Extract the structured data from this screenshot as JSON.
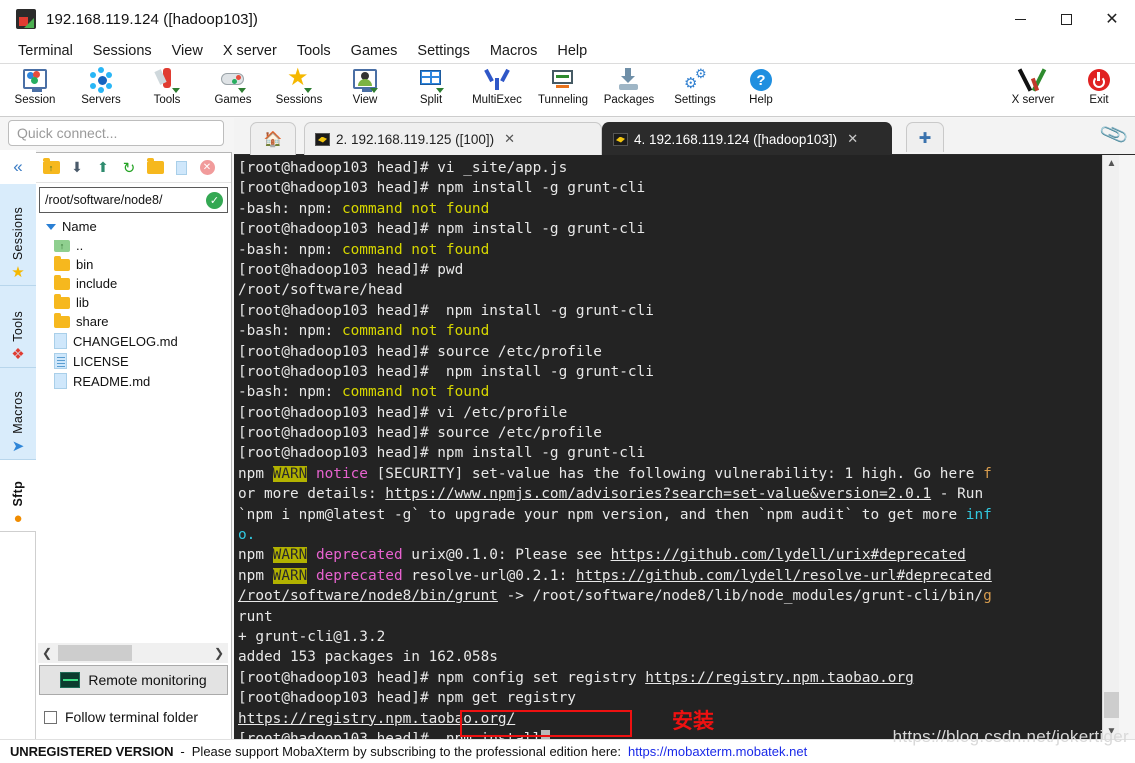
{
  "window": {
    "title": "192.168.119.124 ([hadoop103])",
    "icon": "mobaxterm-logo-icon",
    "controls": {
      "minimize": "–",
      "maximize": "□",
      "close": "✕"
    }
  },
  "menubar": [
    "Terminal",
    "Sessions",
    "View",
    "X server",
    "Tools",
    "Games",
    "Settings",
    "Macros",
    "Help"
  ],
  "toolbar": {
    "left_items": [
      {
        "label": "Session",
        "icon": "session-monitor-icon"
      },
      {
        "label": "Servers",
        "icon": "servers-nodes-icon"
      },
      {
        "label": "Tools",
        "icon": "swiss-knife-icon"
      },
      {
        "label": "Games",
        "icon": "gamepad-icon"
      },
      {
        "label": "Sessions",
        "icon": "star-icon"
      },
      {
        "label": "View",
        "icon": "view-person-monitor-icon"
      },
      {
        "label": "Split",
        "icon": "split-grid-icon"
      },
      {
        "label": "MultiExec",
        "icon": "multiexec-fork-icon"
      },
      {
        "label": "Tunneling",
        "icon": "tunneling-monitor-icon"
      },
      {
        "label": "Packages",
        "icon": "packages-download-icon"
      },
      {
        "label": "Settings",
        "icon": "gear-icon"
      },
      {
        "label": "Help",
        "icon": "help-question-icon"
      }
    ],
    "right_items": [
      {
        "label": "X server",
        "icon": "x-server-icon"
      },
      {
        "label": "Exit",
        "icon": "power-exit-icon"
      }
    ]
  },
  "quick_connect": {
    "placeholder": "Quick connect..."
  },
  "sidebar_tabs": [
    {
      "label": "Sessions",
      "icon": "star-icon",
      "active": true
    },
    {
      "label": "Tools",
      "icon": "swiss-knife-icon",
      "active": true
    },
    {
      "label": "Macros",
      "icon": "paper-plane-icon",
      "active": true
    },
    {
      "label": "Sftp",
      "icon": "globe-icon",
      "active": false
    }
  ],
  "sftp": {
    "toolbar_icons": [
      "folder-up-icon",
      "download-icon",
      "upload-icon",
      "refresh-icon",
      "new-folder-icon",
      "new-file-icon",
      "delete-icon"
    ],
    "path": "/root/software/node8/",
    "path_status_icon": "check-circle-icon",
    "column_header": "Name",
    "files": [
      {
        "name": "..",
        "type": "parent"
      },
      {
        "name": "bin",
        "type": "folder"
      },
      {
        "name": "include",
        "type": "folder"
      },
      {
        "name": "lib",
        "type": "folder"
      },
      {
        "name": "share",
        "type": "folder"
      },
      {
        "name": "CHANGELOG.md",
        "type": "file"
      },
      {
        "name": "LICENSE",
        "type": "file-lines"
      },
      {
        "name": "README.md",
        "type": "file"
      }
    ],
    "remote_monitoring_label": "Remote monitoring",
    "follow_terminal_folder_label": "Follow terminal folder",
    "follow_terminal_folder_checked": false
  },
  "tabs": {
    "home_icon": "home-icon",
    "items": [
      {
        "label": "2. 192.168.119.125 ([100])",
        "active": false,
        "close": "✕",
        "icon": "terminal-icon"
      },
      {
        "label": "4. 192.168.119.124 ([hadoop103])",
        "active": true,
        "close": "✕",
        "icon": "terminal-icon"
      }
    ],
    "new_tab_label": "➕",
    "attach_icon": "paperclip-icon"
  },
  "terminal": {
    "prompt": "[root@hadoop103 head]#",
    "lines": [
      {
        "segs": [
          {
            "t": "[root@hadoop103 head]# vi _site/app.js",
            "c": "c-white"
          }
        ]
      },
      {
        "segs": [
          {
            "t": "[root@hadoop103 head]# npm install -g grunt-cli",
            "c": "c-white"
          }
        ]
      },
      {
        "segs": [
          {
            "t": "-bash: npm: ",
            "c": "c-white"
          },
          {
            "t": "command not found",
            "c": "c-yellow"
          }
        ]
      },
      {
        "segs": [
          {
            "t": "[root@hadoop103 head]# npm install -g grunt-cli",
            "c": "c-white"
          }
        ]
      },
      {
        "segs": [
          {
            "t": "-bash: npm: ",
            "c": "c-white"
          },
          {
            "t": "command not found",
            "c": "c-yellow"
          }
        ]
      },
      {
        "segs": [
          {
            "t": "[root@hadoop103 head]# pwd",
            "c": "c-white"
          }
        ]
      },
      {
        "segs": [
          {
            "t": "/root/software/head",
            "c": "c-white"
          }
        ]
      },
      {
        "segs": [
          {
            "t": "[root@hadoop103 head]#  npm install -g grunt-cli",
            "c": "c-white"
          }
        ]
      },
      {
        "segs": [
          {
            "t": "-bash: npm: ",
            "c": "c-white"
          },
          {
            "t": "command not found",
            "c": "c-yellow"
          }
        ]
      },
      {
        "segs": [
          {
            "t": "[root@hadoop103 head]# source /etc/profile",
            "c": "c-white"
          }
        ]
      },
      {
        "segs": [
          {
            "t": "[root@hadoop103 head]#  npm install -g grunt-cli",
            "c": "c-white"
          }
        ]
      },
      {
        "segs": [
          {
            "t": "-bash: npm: ",
            "c": "c-white"
          },
          {
            "t": "command not found",
            "c": "c-yellow"
          }
        ]
      },
      {
        "segs": [
          {
            "t": "[root@hadoop103 head]# vi /etc/profile",
            "c": "c-white"
          }
        ]
      },
      {
        "segs": [
          {
            "t": "[root@hadoop103 head]# source /etc/profile",
            "c": "c-white"
          }
        ]
      },
      {
        "segs": [
          {
            "t": "[root@hadoop103 head]# npm install -g grunt-cli",
            "c": "c-white"
          }
        ]
      },
      {
        "segs": [
          {
            "t": "npm ",
            "c": "c-white"
          },
          {
            "t": "WARN",
            "c": "c-warn"
          },
          {
            "t": " ",
            "c": "c-white"
          },
          {
            "t": "notice",
            "c": "c-pink"
          },
          {
            "t": " [SECURITY] set-value has the following vulnerability: 1 high. Go here ",
            "c": "c-white"
          },
          {
            "t": "f",
            "c": "c-orange"
          }
        ]
      },
      {
        "segs": [
          {
            "t": "or more details: ",
            "c": "c-white"
          },
          {
            "t": "https://www.npmjs.com/advisories?search=set-value&version=2.0.1",
            "c": "c-link"
          },
          {
            "t": " - Run",
            "c": "c-white"
          }
        ]
      },
      {
        "segs": [
          {
            "t": "`npm i npm@latest -g` to upgrade your npm version, and then `npm audit` to get more ",
            "c": "c-white"
          },
          {
            "t": "inf",
            "c": "c-cyan"
          }
        ]
      },
      {
        "segs": [
          {
            "t": "o.",
            "c": "c-cyan"
          }
        ]
      },
      {
        "segs": [
          {
            "t": "npm ",
            "c": "c-white"
          },
          {
            "t": "WARN",
            "c": "c-warn"
          },
          {
            "t": " ",
            "c": "c-white"
          },
          {
            "t": "deprecated",
            "c": "c-pink"
          },
          {
            "t": " urix@0.1.0: Please see ",
            "c": "c-white"
          },
          {
            "t": "https://github.com/lydell/urix#deprecated",
            "c": "c-link"
          }
        ]
      },
      {
        "segs": [
          {
            "t": "npm ",
            "c": "c-white"
          },
          {
            "t": "WARN",
            "c": "c-warn"
          },
          {
            "t": " ",
            "c": "c-white"
          },
          {
            "t": "deprecated",
            "c": "c-pink"
          },
          {
            "t": " resolve-url@0.2.1: ",
            "c": "c-white"
          },
          {
            "t": "https://github.com/lydell/resolve-url#deprecated",
            "c": "c-link"
          }
        ]
      },
      {
        "segs": [
          {
            "t": "/root/software/node8/bin/grunt",
            "c": "c-link"
          },
          {
            "t": " -> /root/software/node8/lib/node_modules/grunt-cli/bin/",
            "c": "c-white"
          },
          {
            "t": "g",
            "c": "c-orange"
          }
        ]
      },
      {
        "segs": [
          {
            "t": "runt",
            "c": "c-white"
          }
        ]
      },
      {
        "segs": [
          {
            "t": "+ grunt-cli@1.3.2",
            "c": "c-white"
          }
        ]
      },
      {
        "segs": [
          {
            "t": "added 153 packages in 162.058s",
            "c": "c-white"
          }
        ]
      },
      {
        "segs": [
          {
            "t": "[root@hadoop103 head]# npm config set registry ",
            "c": "c-white"
          },
          {
            "t": "https://registry.npm.taobao.org",
            "c": "c-link"
          }
        ]
      },
      {
        "segs": [
          {
            "t": "[root@hadoop103 head]# npm get registry",
            "c": "c-white"
          }
        ]
      },
      {
        "segs": [
          {
            "t": "https://registry.npm.taobao.org/",
            "c": "c-link"
          }
        ]
      },
      {
        "segs": [
          {
            "t": "[root@hadoop103 head]#  npm install",
            "c": "c-white"
          },
          {
            "t": "CURSOR",
            "c": "cursor"
          }
        ]
      }
    ],
    "annotation_text": "安装",
    "annotation_color": "#ee1111",
    "annotation_target": "npm install"
  },
  "statusbar": {
    "unregistered": "UNREGISTERED VERSION",
    "separator": "-",
    "message": "Please support MobaXterm by subscribing to the professional edition here:",
    "link": "https://mobaxterm.mobatek.net"
  },
  "watermark": "https://blog.csdn.net/jokertiger"
}
